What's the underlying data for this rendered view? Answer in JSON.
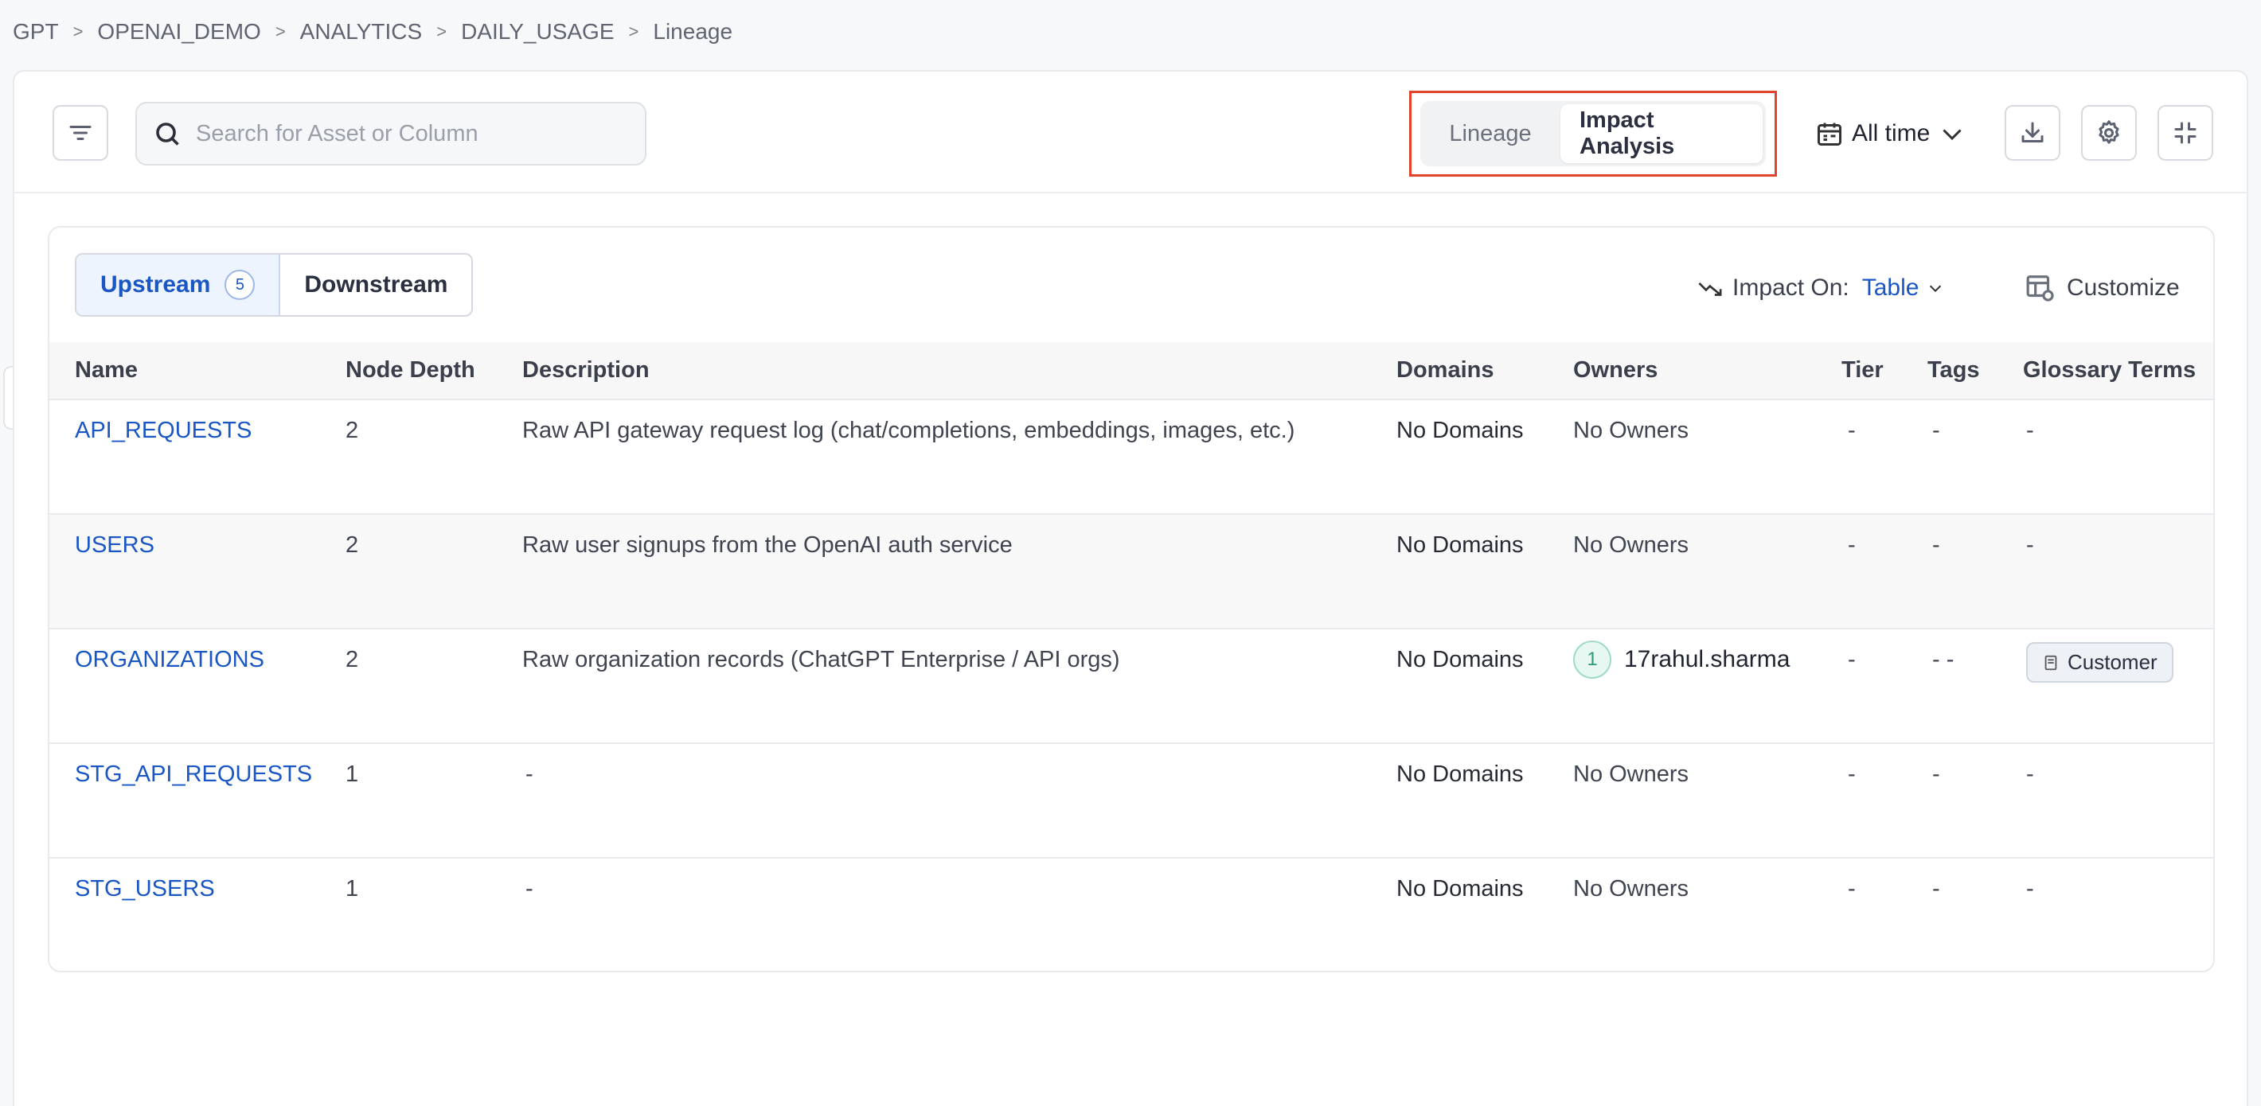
{
  "breadcrumb": {
    "items": [
      "GPT",
      "OPENAI_DEMO",
      "ANALYTICS",
      "DAILY_USAGE"
    ],
    "current": "Lineage",
    "separator": ">"
  },
  "toolbar": {
    "filter_icon": "filter-icon",
    "search_placeholder": "Search for Asset or Column",
    "view_tabs": [
      {
        "label": "Lineage",
        "active": false
      },
      {
        "label": "Impact Analysis",
        "active": true
      }
    ],
    "time_filter": "All time",
    "download_icon": "download-icon",
    "settings_icon": "gear-icon",
    "collapse_icon": "collapse-icon"
  },
  "panel": {
    "direction_tabs": [
      {
        "label": "Upstream",
        "count": "5",
        "active": true
      },
      {
        "label": "Downstream",
        "active": false
      }
    ],
    "impact_on_label": "Impact On:",
    "impact_on_value": "Table",
    "customize_label": "Customize"
  },
  "table": {
    "columns": [
      "Name",
      "Node Depth",
      "Description",
      "Domains",
      "Owners",
      "Tier",
      "Tags",
      "Glossary Terms"
    ],
    "rows": [
      {
        "name": "API_REQUESTS",
        "depth": "2",
        "description": "Raw API gateway request log (chat/completions, embeddings, images, etc.)",
        "domains": "No Domains",
        "owners": "No Owners",
        "tier": "-",
        "tags": "-",
        "glossary": "-"
      },
      {
        "name": "USERS",
        "depth": "2",
        "description": "Raw user signups from the OpenAI auth service",
        "domains": "No Domains",
        "owners": "No Owners",
        "tier": "-",
        "tags": "-",
        "glossary": "-"
      },
      {
        "name": "ORGANIZATIONS",
        "depth": "2",
        "description": "Raw organization records (ChatGPT Enterprise / API orgs)",
        "domains": "No Domains",
        "owner_avatar": "1",
        "owner_name": "17rahul.sharma",
        "tier": "-",
        "tags": "- -",
        "glossary_tag": "Customer"
      },
      {
        "name": "STG_API_REQUESTS",
        "depth": "1",
        "description": "-",
        "domains": "No Domains",
        "owners": "No Owners",
        "tier": "-",
        "tags": "-",
        "glossary": "-"
      },
      {
        "name": "STG_USERS",
        "depth": "1",
        "description": "-",
        "domains": "No Domains",
        "owners": "No Owners",
        "tier": "-",
        "tags": "-",
        "glossary": "-"
      }
    ]
  },
  "colors": {
    "accent": "#1a56c4",
    "highlight_frame": "#e2432b",
    "owner_avatar": "#2a9d74"
  }
}
